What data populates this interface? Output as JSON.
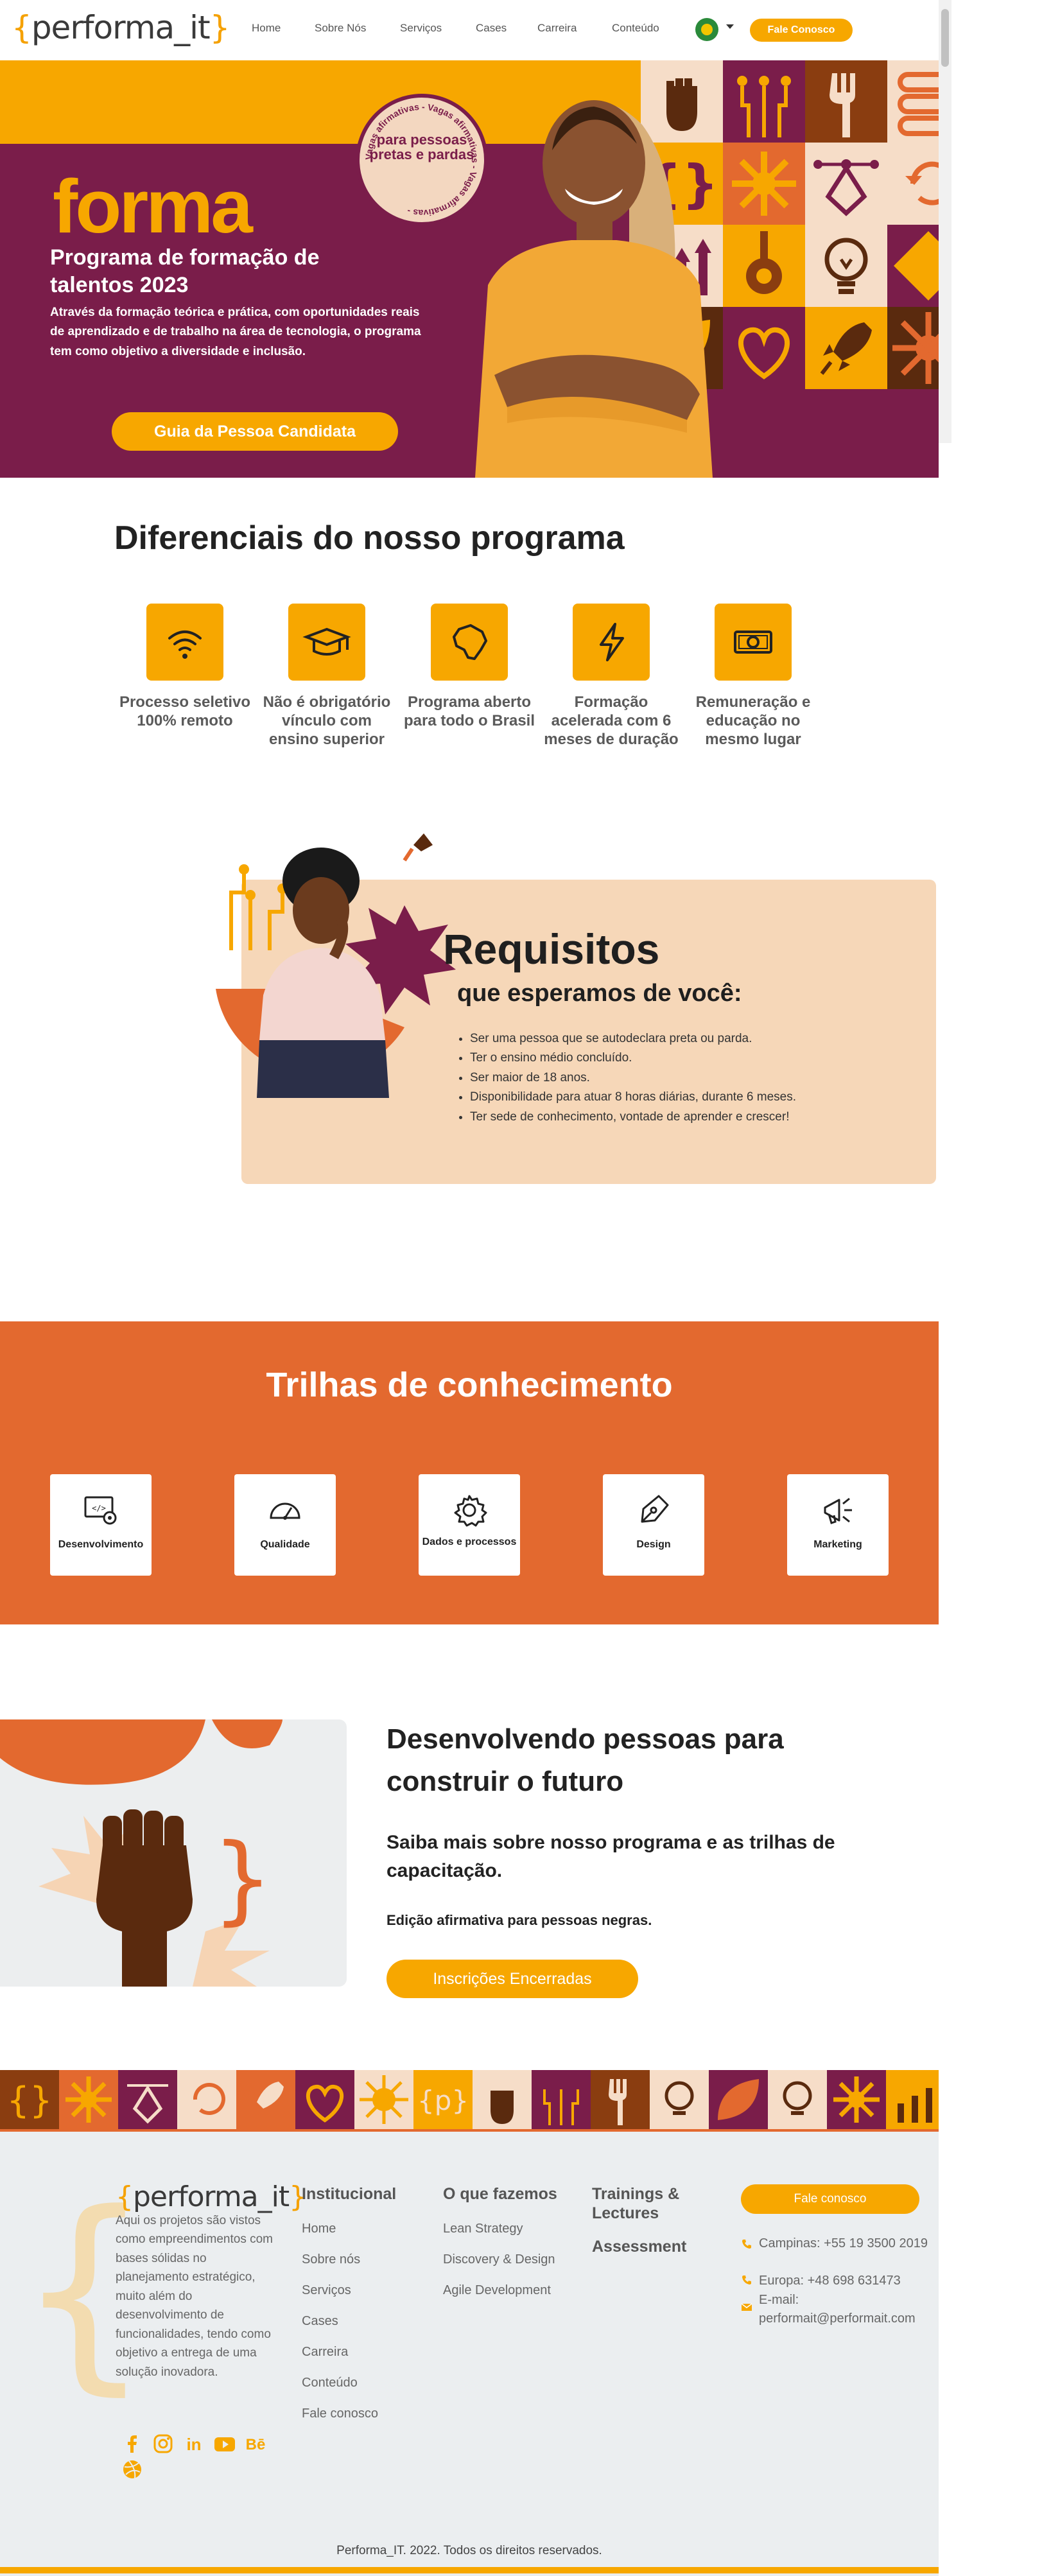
{
  "header": {
    "logo_text": "performa_it",
    "nav": [
      "Home",
      "Sobre Nós",
      "Serviços",
      "Cases",
      "Carreira",
      "Conteúdo"
    ],
    "cta": "Fale Conosco"
  },
  "hero": {
    "big_word": "forma",
    "badge_ring": "Vagas afirmativas - Vagas afirmativas - Vagas afirmativas -",
    "badge_text": "para pessoas pretas e pardas",
    "title": "Programa de formação de talentos 2023",
    "description": "Através da formação teórica e prática, com oportunidades reais de aprendizado e de trabalho na área de tecnologia, o programa tem como objetivo a diversidade e inclusão.",
    "button": "Guia da Pessoa Candidata"
  },
  "diferenciais": {
    "title": "Diferenciais do nosso programa",
    "items": [
      {
        "icon": "wifi-icon",
        "label": "Processo seletivo 100% remoto"
      },
      {
        "icon": "graduation-cap-icon",
        "label": "Não é obrigatório vínculo com ensino superior"
      },
      {
        "icon": "brazil-map-icon",
        "label": "Programa aberto para todo o Brasil"
      },
      {
        "icon": "lightning-icon",
        "label": "Formação acelerada com 6 meses de duração"
      },
      {
        "icon": "money-icon",
        "label": "Remuneração e educação no mesmo lugar"
      }
    ]
  },
  "requisitos": {
    "title": "Requisitos",
    "subtitle": "que esperamos de você:",
    "items": [
      "Ser uma pessoa que se autodeclara preta ou parda.",
      "Ter o ensino médio concluído.",
      "Ser maior de 18 anos.",
      "Disponibilidade para atuar 8 horas diárias, durante 6 meses.",
      "Ter sede de conhecimento, vontade de aprender e crescer!"
    ]
  },
  "trilhas": {
    "title": "Trilhas de conhecimento",
    "items": [
      {
        "icon": "code-monitor-icon",
        "label": "Desenvolvimento"
      },
      {
        "icon": "gauge-icon",
        "label": "Qualidade"
      },
      {
        "icon": "gear-icon",
        "label": "Dados e processos"
      },
      {
        "icon": "pen-nib-icon",
        "label": "Design"
      },
      {
        "icon": "megaphone-icon",
        "label": "Marketing"
      }
    ]
  },
  "desenvolvendo": {
    "title": "Desenvolvendo pessoas para construir o futuro",
    "subtitle": "Saiba mais sobre nosso programa e as trilhas de capacitação.",
    "edition": "Edição afirmativa para pessoas negras.",
    "button": "Inscrições Encerradas"
  },
  "footer": {
    "logo_text": "performa_it",
    "description": "Aqui os projetos são vistos como empreendimentos com bases sólidas no planejamento estratégico, muito além do desenvolvimento de funcionalidades, tendo como objetivo a entrega de uma solução inovadora.",
    "institucional": {
      "title": "Institucional",
      "links": [
        "Home",
        "Sobre nós",
        "Serviços",
        "Cases",
        "Carreira",
        "Conteúdo",
        "Fale conosco"
      ]
    },
    "o_que_fazemos": {
      "title": "O que fazemos",
      "links": [
        "Lean Strategy",
        "Discovery & Design",
        "Agile Development"
      ]
    },
    "trainings": "Trainings & Lectures",
    "assessment": "Assessment",
    "contact_button": "Fale conosco",
    "contacts": [
      {
        "icon": "phone-icon",
        "text": "Campinas: +55 19 3500 2019"
      },
      {
        "icon": "phone-icon",
        "text": "Europa: +48 698 631473"
      },
      {
        "icon": "mail-icon",
        "text": "E-mail: performait@performait.com"
      }
    ],
    "socials": [
      "facebook-icon",
      "instagram-icon",
      "linkedin-icon",
      "youtube-icon",
      "behance-icon",
      "dribbble-icon"
    ],
    "copyright": "Performa_IT. 2022. Todos os direitos reservados."
  },
  "colors": {
    "accent_yellow": "#f7a700",
    "wine": "#7a1d4a",
    "orange": "#e3692f",
    "peach": "#f6d7b8",
    "brown": "#5a2a0e"
  }
}
